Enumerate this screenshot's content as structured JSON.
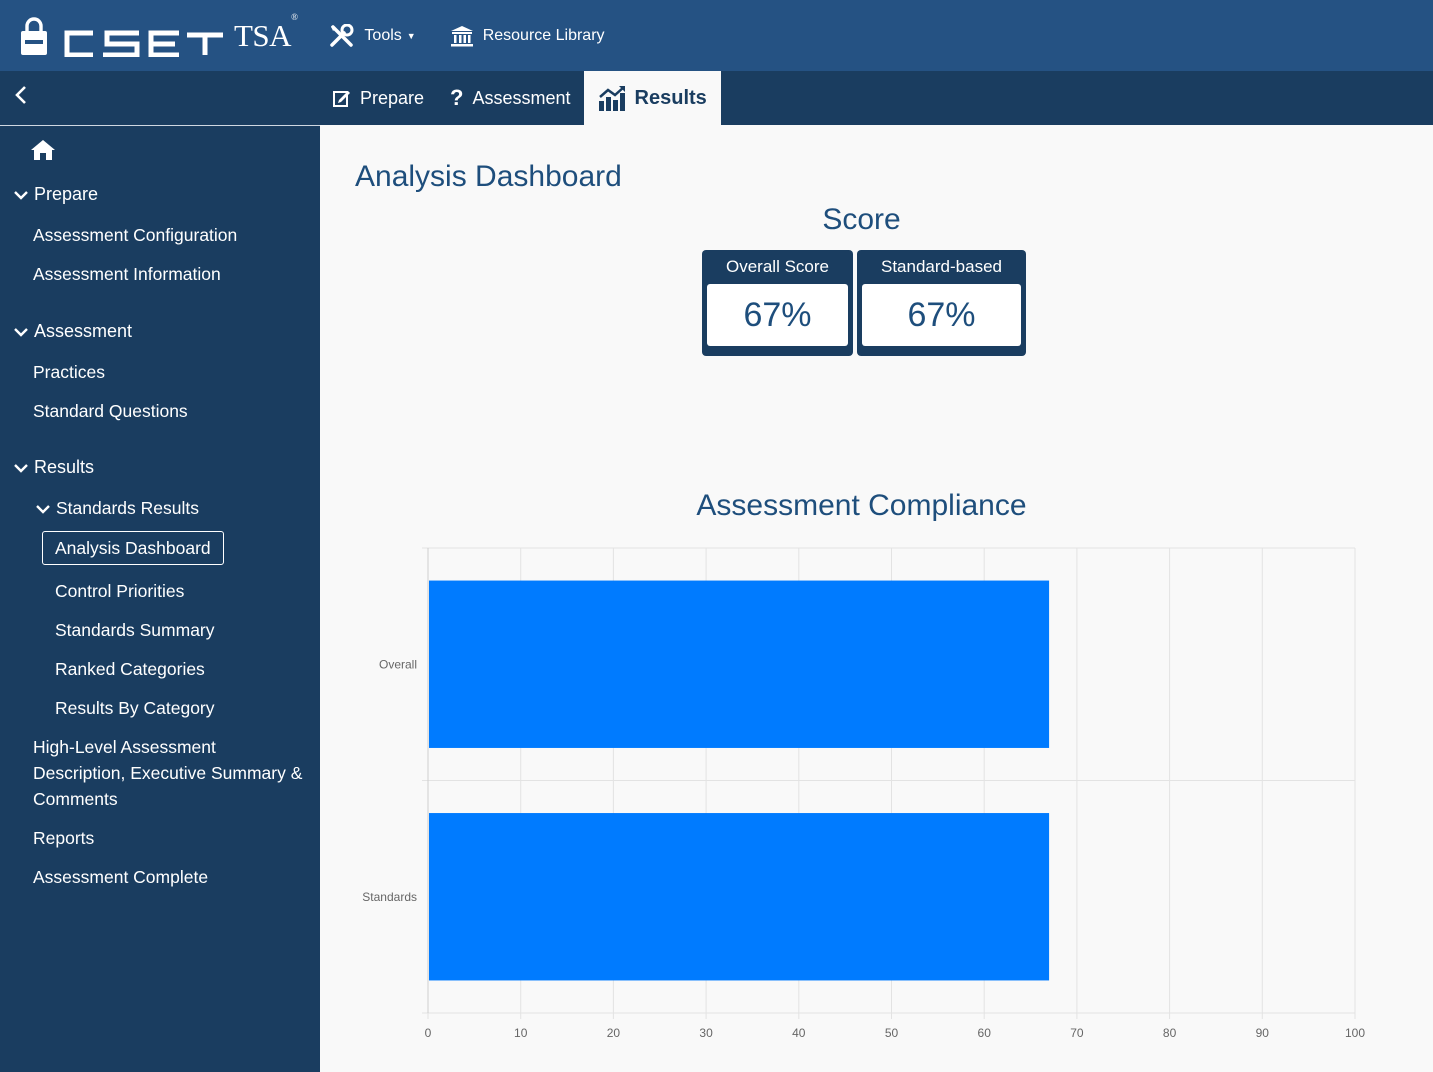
{
  "app": {
    "brand_suffix": "TSA",
    "trademark": "®",
    "tools_label": "Tools",
    "resource_library_label": "Resource Library"
  },
  "phases": [
    {
      "label": "Prepare",
      "active": false
    },
    {
      "label": "Assessment",
      "active": false
    },
    {
      "label": "Results",
      "active": true
    }
  ],
  "sidebar": {
    "prepare": "Prepare",
    "assessment_configuration": "Assessment Configuration",
    "assessment_information": "Assessment Information",
    "assessment": "Assessment",
    "practices": "Practices",
    "standard_questions": "Standard Questions",
    "results": "Results",
    "standards_results": "Standards Results",
    "analysis_dashboard": "Analysis Dashboard",
    "control_priorities": "Control Priorities",
    "standards_summary": "Standards Summary",
    "ranked_categories": "Ranked Categories",
    "results_by_category": "Results By Category",
    "high_level_line1": "High-Level Assessment",
    "high_level_line2": "Description, Executive Summary &",
    "high_level_line3": "Comments",
    "reports": "Reports",
    "assessment_complete": "Assessment Complete"
  },
  "main": {
    "page_title": "Analysis Dashboard",
    "score_title": "Score",
    "overall_score_label": "Overall Score",
    "overall_score_value": "67%",
    "standard_based_label": "Standard-based",
    "standard_based_value": "67%",
    "compliance_title": "Assessment Compliance"
  },
  "colors": {
    "bar": "#007bff",
    "nav_dark": "#1a3d60",
    "nav_top": "#255283"
  },
  "chart_data": {
    "type": "bar",
    "orientation": "horizontal",
    "categories": [
      "Overall",
      "Standards"
    ],
    "values": [
      67,
      67
    ],
    "xlim": [
      0,
      100
    ],
    "xticks": [
      0,
      10,
      20,
      30,
      40,
      50,
      60,
      70,
      80,
      90,
      100
    ],
    "grid": true,
    "title": "Assessment Compliance"
  }
}
